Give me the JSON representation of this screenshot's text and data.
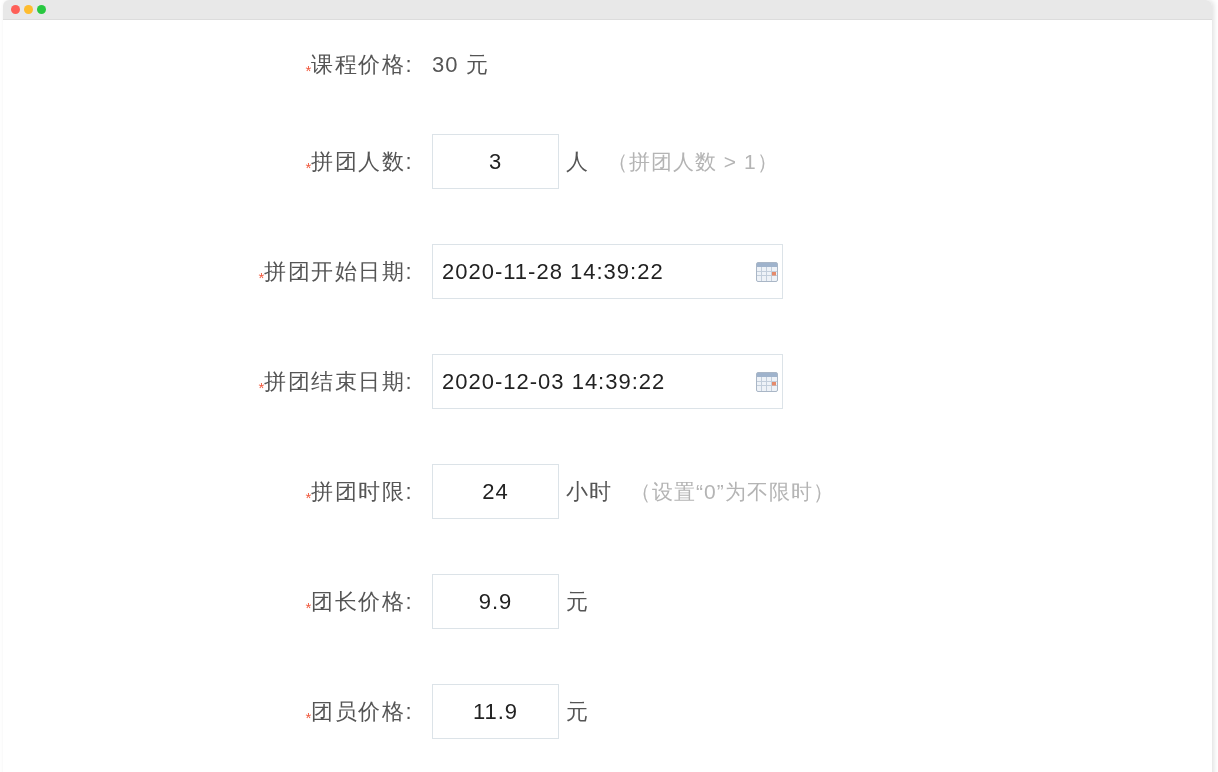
{
  "form": {
    "fields": [
      {
        "kind": "static",
        "required_mark": "*",
        "label": "课程价格:",
        "value": "30 元"
      },
      {
        "kind": "number",
        "required_mark": "*",
        "label": "拼团人数:",
        "value": "3",
        "unit": "人",
        "hint": "（拼团人数 > 1）"
      },
      {
        "kind": "datetime",
        "required_mark": "*",
        "label": "拼团开始日期:",
        "value": "2020-11-28 14:39:22"
      },
      {
        "kind": "datetime",
        "required_mark": "*",
        "label": "拼团结束日期:",
        "value": "2020-12-03 14:39:22"
      },
      {
        "kind": "number",
        "required_mark": "*",
        "label": "拼团时限:",
        "value": "24",
        "unit": "小时",
        "hint": "（设置“0”为不限时）"
      },
      {
        "kind": "number",
        "required_mark": "*",
        "label": "团长价格:",
        "value": "9.9",
        "unit": "元"
      },
      {
        "kind": "number",
        "required_mark": "*",
        "label": "团员价格:",
        "value": "11.9",
        "unit": "元"
      }
    ]
  }
}
